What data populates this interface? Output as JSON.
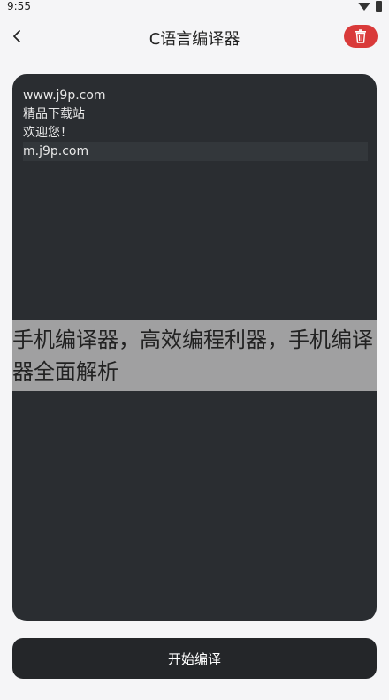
{
  "status_bar": {
    "time": "9:55"
  },
  "app_bar": {
    "title": "C语言编译器"
  },
  "editor": {
    "lines": [
      "www.j9p.com",
      "精品下载站",
      "欢迎您！",
      "m.j9p.com"
    ]
  },
  "overlay": {
    "text": "手机编译器，高效编程利器，手机编译器全面解析"
  },
  "actions": {
    "compile_label": "开始编译"
  },
  "colors": {
    "accent_delete": "#d93a3a",
    "editor_bg": "#2a2d31",
    "button_bg": "#242629"
  }
}
